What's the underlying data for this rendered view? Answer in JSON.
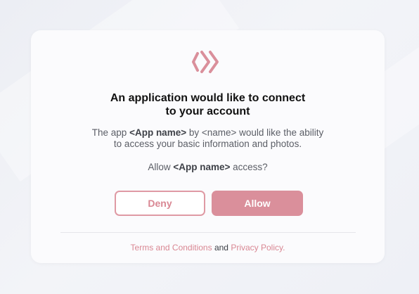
{
  "dialog": {
    "title_line1": "An application would like to connect",
    "title_line2": "to your account",
    "desc_prefix": "The app ",
    "app_name": "<App name>",
    "desc_by": " by ",
    "owner_name": "<name>",
    "desc_line1_suffix": " would like the ability",
    "desc_line2": "to access your basic information and photos.",
    "allow_prefix": "Allow ",
    "allow_suffix": " access?",
    "deny_label": "Deny",
    "allow_label": "Allow",
    "terms_label": "Terms and Conditions",
    "and_text": " and ",
    "privacy_label": "Privacy Policy."
  },
  "colors": {
    "accent": "#DA8F9B",
    "accent_text": "#D98793",
    "card_bg": "#FBFBFD"
  },
  "icons": {
    "logo": "double-chevron-right-logo"
  }
}
